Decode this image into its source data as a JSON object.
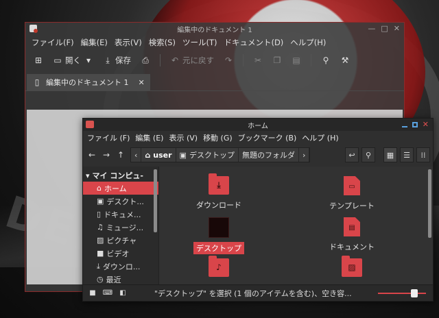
{
  "editor": {
    "title": "編集中のドキュメント 1",
    "menu": [
      "ファイル(F)",
      "編集(E)",
      "表示(V)",
      "検索(S)",
      "ツール(T)",
      "ドキュメント(D)",
      "ヘルプ(H)"
    ],
    "toolbar": {
      "open_label": "開く",
      "save_label": "保存",
      "undo_label": "元に戻す"
    },
    "tab_label": "編集中のドキュメント 1",
    "window_buttons": [
      "—",
      "□",
      "✕"
    ]
  },
  "fm": {
    "title": "ホーム",
    "menu": [
      "ファイル (F)",
      "編集 (E)",
      "表示 (V)",
      "移動 (G)",
      "ブックマーク (B)",
      "ヘルプ (H)"
    ],
    "breadcrumbs": [
      "user",
      "デスクトップ",
      "無題のフォルダ"
    ],
    "sidebar": {
      "header": "マイ コンピュ-",
      "items": [
        "ホーム",
        "デスクト...",
        "ドキュメ...",
        "ミュージ...",
        "ピクチャ",
        "ビデオ",
        "ダウンロ...",
        "最近"
      ]
    },
    "items": {
      "downloads": "ダウンロード",
      "templates": "テンプレート",
      "desktop": "デスクトップ",
      "documents": "ドキュメント"
    },
    "status_text": "\"デスクトップ\" を選択 (1 個のアイテムを含む)、空き容...",
    "zoom_level": 0.8
  },
  "colors": {
    "accent": "#d9454a",
    "window_bg": "#2f2f2f"
  },
  "wallpaper_text": "DEP"
}
